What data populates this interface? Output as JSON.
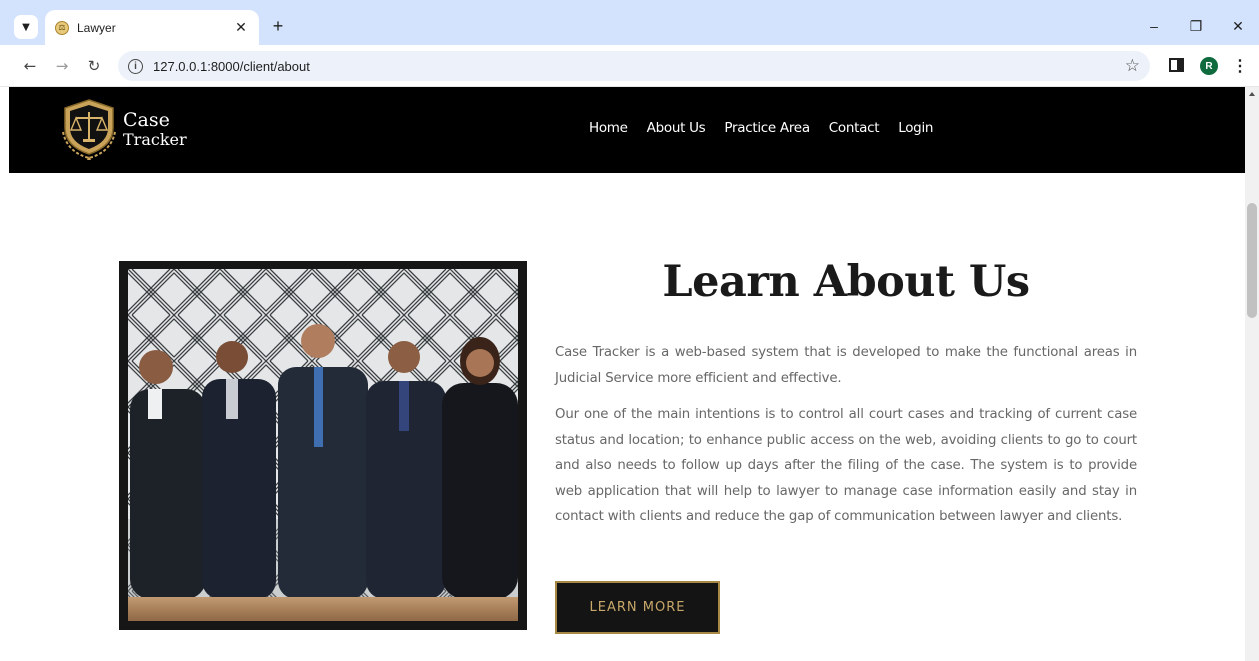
{
  "browser": {
    "tab_title": "Lawyer",
    "url": "127.0.0.1:8000/client/about",
    "profile_initial": "R"
  },
  "site": {
    "logo": {
      "line1": "Case",
      "line2": "Tracker"
    },
    "nav": [
      "Home",
      "About Us",
      "Practice Area",
      "Contact",
      "Login"
    ]
  },
  "about": {
    "heading": "Learn About Us",
    "paragraph1": "Case Tracker is a web-based system that is developed to make the functional areas in Judicial Service more efficient and effective.",
    "paragraph2": "Our one of the main intentions is to control all court cases and tracking of current case status and location; to enhance public access on the web, avoiding clients to go to court and also needs to follow up days after the filing of the case. The system is to provide web application that will help to lawyer to manage case information easily and stay in contact with clients and reduce the gap of communication between lawyer and clients.",
    "button_label": "LEARN MORE"
  },
  "colors": {
    "nav_bg": "#000000",
    "gold": "#a88845",
    "button_text": "#c8a86a",
    "browser_chrome": "#d3e3fd"
  },
  "icons": [
    "tab-search-icon",
    "balance-scale-favicon-icon",
    "close-icon",
    "new-tab-icon",
    "minimize-icon",
    "restore-icon",
    "window-close-icon",
    "back-icon",
    "forward-icon",
    "reload-icon",
    "info-icon",
    "bookmark-star-icon",
    "side-panel-icon",
    "menu-kebab-icon",
    "balance-scale-logo-icon"
  ]
}
